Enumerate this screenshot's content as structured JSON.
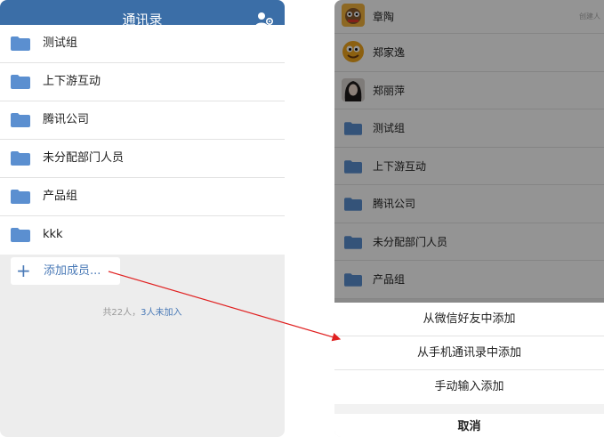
{
  "left_screen": {
    "header": {
      "title": "通讯录",
      "add_member_icon": "add-person-icon"
    },
    "groups": [
      {
        "label": "测试组"
      },
      {
        "label": "上下游互动"
      },
      {
        "label": "腾讯公司"
      },
      {
        "label": "未分配部门人员"
      },
      {
        "label": "产品组"
      },
      {
        "label": "kkk"
      }
    ],
    "add_member": {
      "icon": "plus",
      "label": "添加成员..."
    },
    "summary": {
      "total": "共22人，",
      "pending": "3人未加入"
    }
  },
  "right_screen": {
    "members": [
      {
        "name": "章陶",
        "tag": "创建人",
        "avatar": "cartoon-avatar"
      },
      {
        "name": "郑家逸",
        "avatar": "emoji-face-avatar"
      },
      {
        "name": "郑丽萍",
        "avatar": "photo-avatar"
      }
    ],
    "groups": [
      {
        "label": "测试组"
      },
      {
        "label": "上下游互动"
      },
      {
        "label": "腾讯公司"
      },
      {
        "label": "未分配部门人员"
      },
      {
        "label": "产品组"
      }
    ],
    "action_sheet": {
      "options": [
        "从微信好友中添加",
        "从手机通讯录中添加",
        "手动输入添加"
      ],
      "cancel": "取消"
    }
  },
  "colors": {
    "header": "#3b6ea7",
    "accent": "#4a7ab7",
    "folder": "#5b8fd0",
    "arrow": "#e02020"
  }
}
